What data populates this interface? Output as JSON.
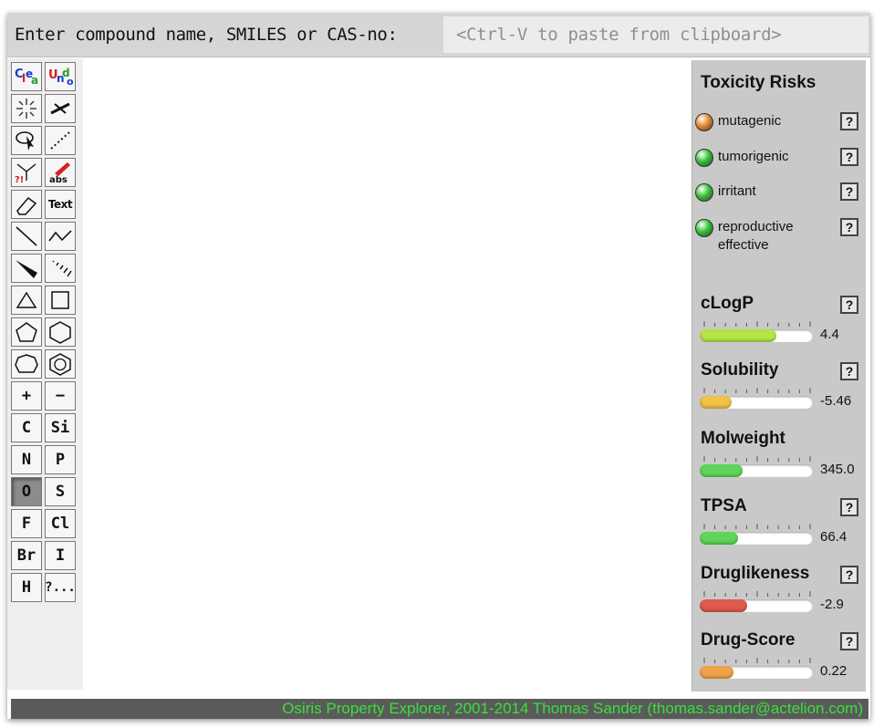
{
  "header": {
    "prompt": "Enter compound name, SMILES or CAS-no:",
    "input_placeholder": "<Ctrl-V to paste from clipboard>",
    "input_value": ""
  },
  "tools": {
    "text_tool": "Text",
    "abs_tool": "abs",
    "atoms": [
      "C",
      "Si",
      "N",
      "P",
      "O",
      "S",
      "F",
      "Cl",
      "Br",
      "I",
      "H",
      "?..."
    ],
    "selected_atom": "O",
    "charge_plus": "+",
    "charge_minus": "−"
  },
  "panel": {
    "title": "Toxicity Risks",
    "help_label": "?",
    "risks": [
      {
        "label": "mutagenic",
        "level": "medium",
        "color": "#e8892a"
      },
      {
        "label": "tumorigenic",
        "level": "none",
        "color": "#33c533"
      },
      {
        "label": "irritant",
        "level": "none",
        "color": "#33c533"
      },
      {
        "label": "reproductive effective",
        "level": "none",
        "color": "#33c533"
      }
    ],
    "properties": [
      {
        "name": "cLogP",
        "value": "4.4",
        "fill_fraction": 0.68,
        "color": "#b6e34a",
        "has_help": true
      },
      {
        "name": "Solubility",
        "value": "-5.46",
        "fill_fraction": 0.28,
        "color": "#f0c24a",
        "has_help": true
      },
      {
        "name": "Molweight",
        "value": "345.0",
        "fill_fraction": 0.38,
        "color": "#5fd65a",
        "has_help": false
      },
      {
        "name": "TPSA",
        "value": "66.4",
        "fill_fraction": 0.34,
        "color": "#5fd65a",
        "has_help": true
      },
      {
        "name": "Druglikeness",
        "value": "-2.9",
        "fill_fraction": 0.42,
        "color": "#e05a4e",
        "has_help": true
      },
      {
        "name": "Drug-Score",
        "value": "0.22",
        "fill_fraction": 0.3,
        "color": "#f0a24a",
        "has_help": true
      }
    ]
  },
  "status": {
    "text": "Osiris Property Explorer, 2001-2014 Thomas Sander (thomas.sander@actelion.com)"
  }
}
